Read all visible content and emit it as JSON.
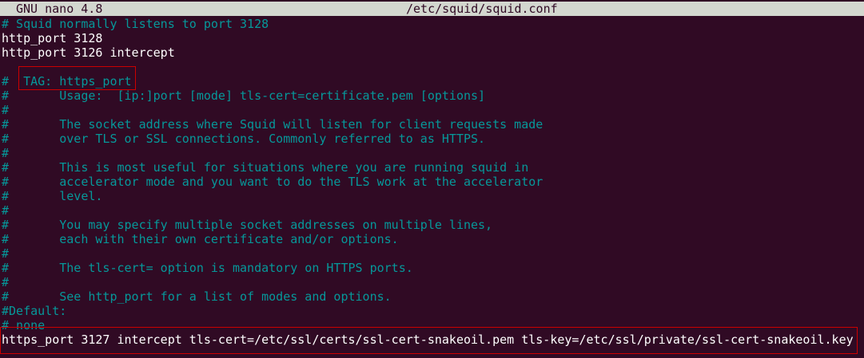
{
  "title_bar": {
    "app_name": "GNU nano 4.8",
    "file_path": "/etc/squid/squid.conf"
  },
  "lines": [
    {
      "text": "# Squid normally listens to port 3128",
      "kind": "comment"
    },
    {
      "text": "http_port 3128",
      "kind": "code"
    },
    {
      "text": "http_port 3126 intercept",
      "kind": "code"
    },
    {
      "text": "",
      "kind": "code"
    },
    {
      "text": "#  TAG: https_port",
      "kind": "comment"
    },
    {
      "text": "#       Usage:  [ip:]port [mode] tls-cert=certificate.pem [options]",
      "kind": "comment"
    },
    {
      "text": "#",
      "kind": "comment"
    },
    {
      "text": "#       The socket address where Squid will listen for client requests made",
      "kind": "comment"
    },
    {
      "text": "#       over TLS or SSL connections. Commonly referred to as HTTPS.",
      "kind": "comment"
    },
    {
      "text": "#",
      "kind": "comment"
    },
    {
      "text": "#       This is most useful for situations where you are running squid in",
      "kind": "comment"
    },
    {
      "text": "#       accelerator mode and you want to do the TLS work at the accelerator",
      "kind": "comment"
    },
    {
      "text": "#       level.",
      "kind": "comment"
    },
    {
      "text": "#",
      "kind": "comment"
    },
    {
      "text": "#       You may specify multiple socket addresses on multiple lines,",
      "kind": "comment"
    },
    {
      "text": "#       each with their own certificate and/or options.",
      "kind": "comment"
    },
    {
      "text": "#",
      "kind": "comment"
    },
    {
      "text": "#       The tls-cert= option is mandatory on HTTPS ports.",
      "kind": "comment"
    },
    {
      "text": "#",
      "kind": "comment"
    },
    {
      "text": "#       See http_port for a list of modes and options.",
      "kind": "comment"
    },
    {
      "text": "#Default:",
      "kind": "comment"
    },
    {
      "text": "# none",
      "kind": "comment"
    },
    {
      "text": "https_port 3127 intercept tls-cert=/etc/ssl/certs/ssl-cert-snakeoil.pem tls-key=/etc/ssl/private/ssl-cert-snakeoil.key",
      "kind": "code"
    }
  ],
  "colors": {
    "background": "#300a24",
    "comment": "#06989a",
    "code": "#ffffff",
    "title_bar_bg": "#d3d7cf",
    "highlight_border": "#cc0000"
  }
}
